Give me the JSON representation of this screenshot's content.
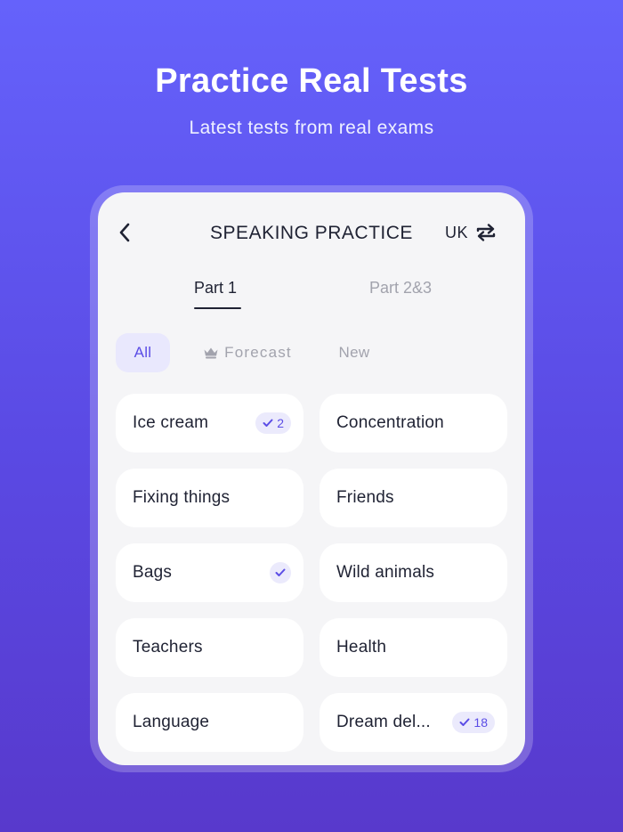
{
  "hero": {
    "title": "Practice Real Tests",
    "subtitle": "Latest tests from real exams"
  },
  "header": {
    "title": "SPEAKING PRACTICE",
    "region": "UK",
    "back_icon": "chevron-left-icon",
    "region_icon": "swap-arrows-icon"
  },
  "tabs": [
    {
      "label": "Part 1",
      "active": true
    },
    {
      "label": "Part 2&3",
      "active": false
    }
  ],
  "filters": [
    {
      "label": "All",
      "selected": true
    },
    {
      "label": "Forecast",
      "icon": "crown-icon",
      "selected": false
    },
    {
      "label": "New",
      "selected": false
    }
  ],
  "topics": [
    {
      "label": "Ice cream",
      "done": true,
      "count": "2"
    },
    {
      "label": "Concentration",
      "done": false,
      "count": ""
    },
    {
      "label": "Fixing things",
      "done": false,
      "count": ""
    },
    {
      "label": "Friends",
      "done": false,
      "count": ""
    },
    {
      "label": "Bags",
      "done": true,
      "count": ""
    },
    {
      "label": "Wild animals",
      "done": false,
      "count": ""
    },
    {
      "label": "Teachers",
      "done": false,
      "count": ""
    },
    {
      "label": "Health",
      "done": false,
      "count": ""
    },
    {
      "label": "Language",
      "done": false,
      "count": ""
    },
    {
      "label": "Dream del...",
      "done": true,
      "count": "18"
    }
  ],
  "colors": {
    "accent": "#5b4de6",
    "badge_bg": "#ebeafc",
    "text": "#1f2233",
    "muted": "#a2a3ad"
  }
}
